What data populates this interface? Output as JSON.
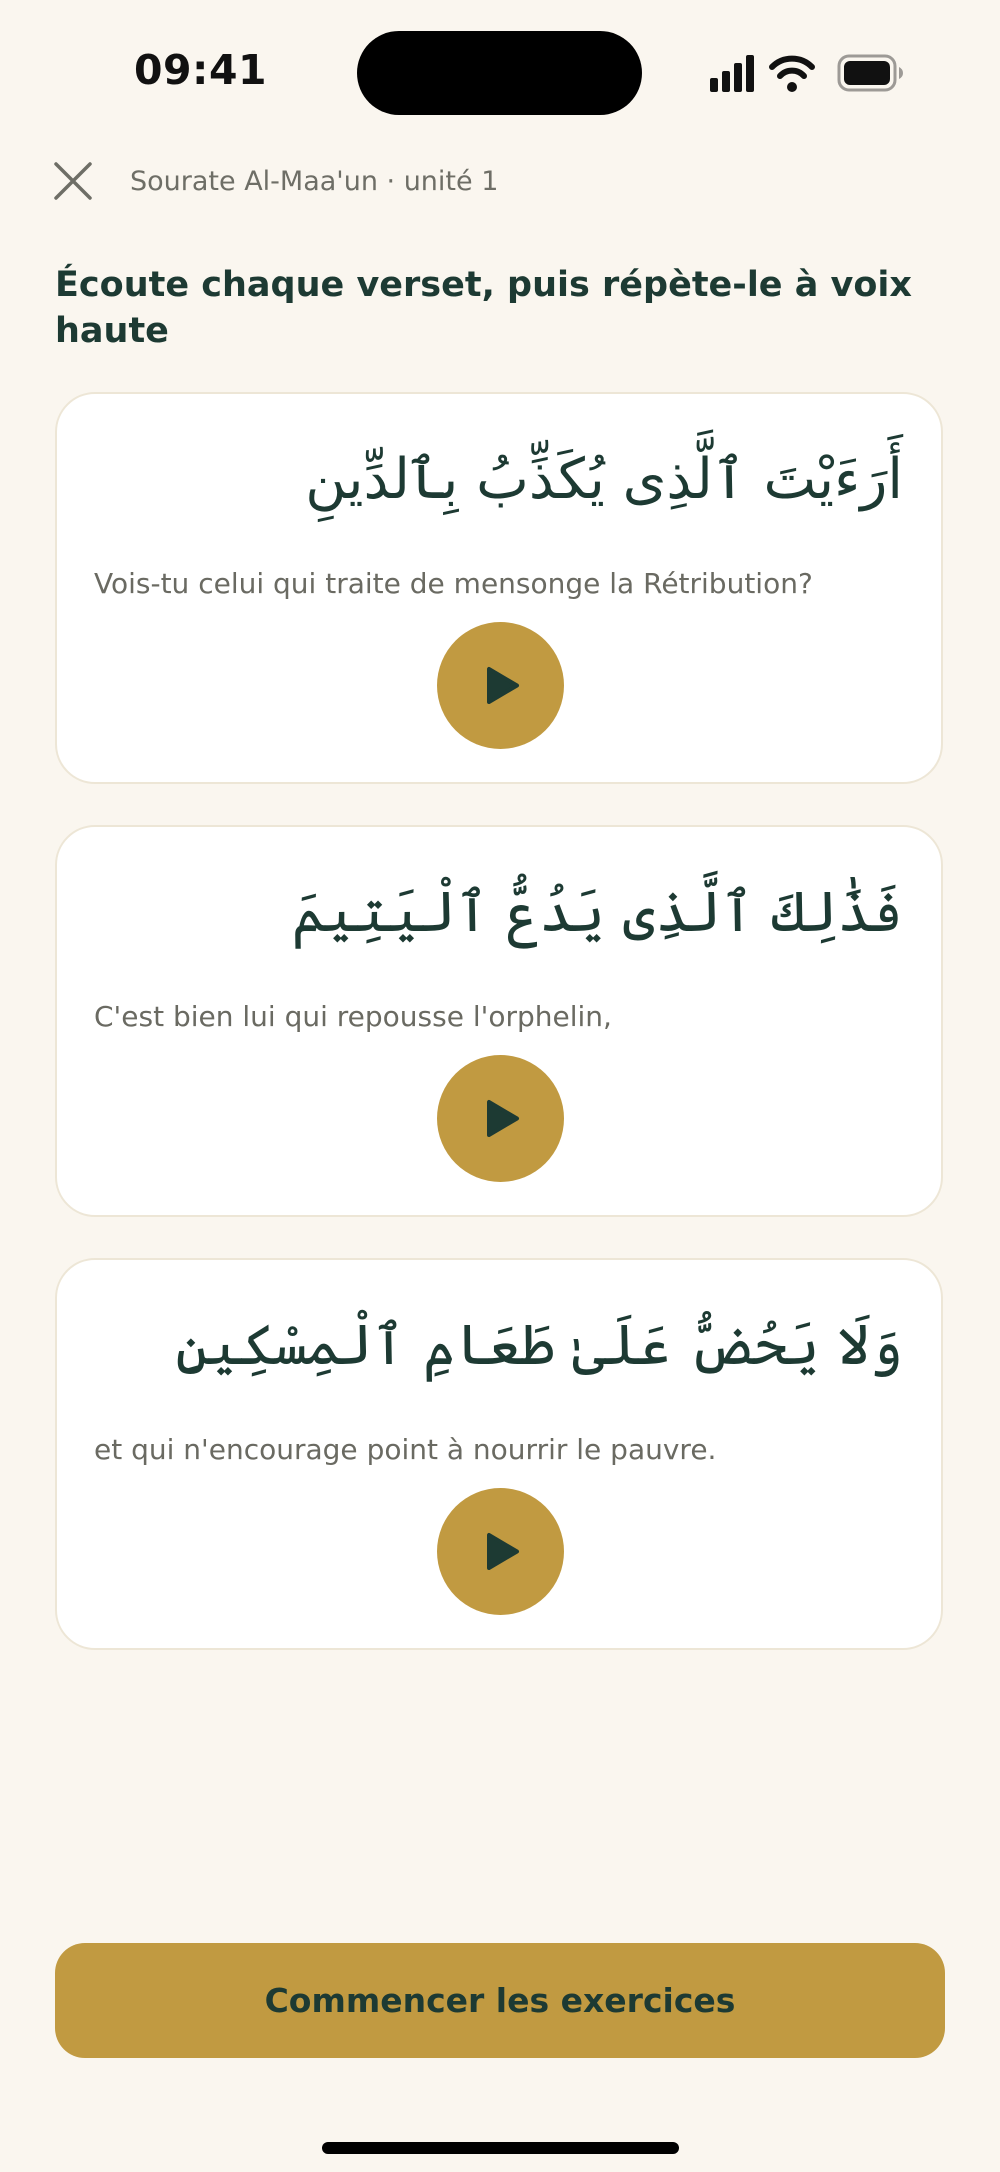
{
  "status_bar": {
    "time": "09:41"
  },
  "header": {
    "breadcrumb": "Sourate Al-Maa'un · unité 1"
  },
  "instruction": "Écoute chaque verset, puis répète-le à voix haute",
  "verses": [
    {
      "arabic": "أَرَءَيْتَ ٱلَّذِى يُكَذِّبُ بِٱلدِّينِ",
      "translation": "Vois-tu celui qui traite de mensonge la Rétribution?"
    },
    {
      "arabic": "فَذَٰلِكَ ٱلَّذِى يَدُعُّ ٱلْيَتِيمَ",
      "translation": "C'est bien lui qui repousse l'orphelin,"
    },
    {
      "arabic": "وَلَا يَحُضُّ عَلَىٰ طَعَامِ ٱلْمِسْكِينِ",
      "translation": "et qui n'encourage point à nourrir le pauvre."
    }
  ],
  "cta": {
    "label": "Commencer les exercices"
  },
  "icons": {
    "close": "close-icon",
    "play": "play-icon",
    "signal": "signal-icon",
    "wifi": "wifi-icon",
    "battery": "battery-icon"
  },
  "colors": {
    "background": "#faf6ef",
    "accent": "#c19a41",
    "text_dark": "#1d3a33",
    "text_muted": "#6a6a62"
  }
}
